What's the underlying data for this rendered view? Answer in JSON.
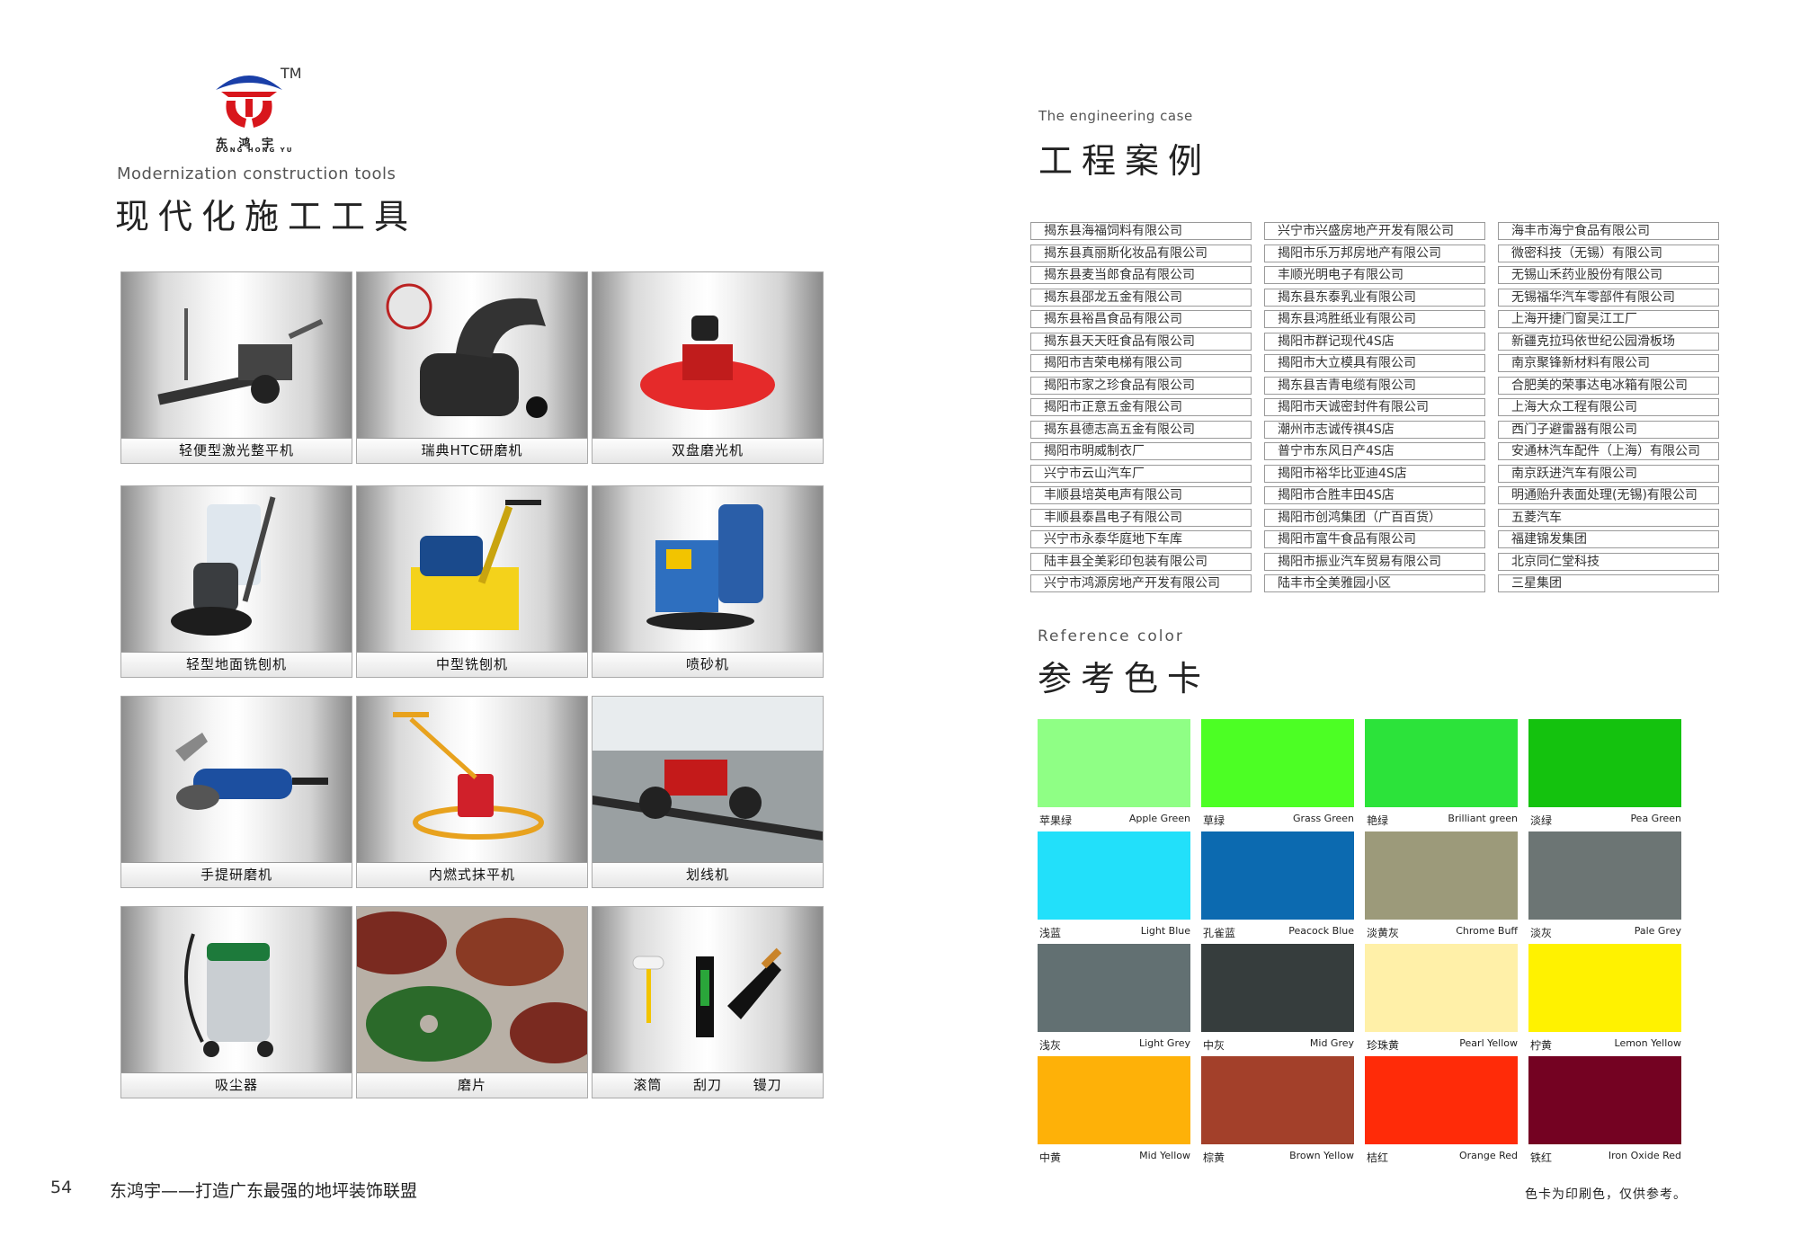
{
  "left": {
    "logo": {
      "tm": "TM",
      "name": "东 鸿 宇",
      "sub": "DONG HONG YU"
    },
    "title_en": "Modernization construction tools",
    "title_cn": "现代化施工工具",
    "tools": [
      {
        "label": "轻便型激光整平机"
      },
      {
        "label": "瑞典HTC研磨机"
      },
      {
        "label": "双盘磨光机"
      },
      {
        "label": "轻型地面铣刨机"
      },
      {
        "label": "中型铣刨机"
      },
      {
        "label": "喷砂机"
      },
      {
        "label": "手提研磨机"
      },
      {
        "label": "内燃式抹平机"
      },
      {
        "label": "划线机"
      },
      {
        "label": "吸尘器"
      },
      {
        "label": "磨片"
      },
      {
        "label": "滚筒      刮刀      镘刀"
      }
    ],
    "page_number": "54",
    "slogan": "东鸿宇——打造广东最强的地坪装饰联盟"
  },
  "right": {
    "cases_en": "The engineering case",
    "cases_cn": "工程案例",
    "cases": [
      [
        "揭东县海福饲料有限公司",
        "揭东县真丽斯化妆品有限公司",
        "揭东县麦当郎食品有限公司",
        "揭东县邵龙五金有限公司",
        "揭东县裕昌食品有限公司",
        "揭东县天天旺食品有限公司",
        "揭阳市吉荣电梯有限公司",
        "揭阳市家之珍食品有限公司",
        "揭阳市正意五金有限公司",
        "揭东县德志高五金有限公司",
        "揭阳市明威制衣厂",
        "兴宁市云山汽车厂",
        "丰顺县培英电声有限公司",
        "丰顺县泰昌电子有限公司",
        "兴宁市永泰华庭地下车库",
        "陆丰县全美彩印包装有限公司",
        "兴宁市鸿源房地产开发有限公司"
      ],
      [
        "兴宁市兴盛房地产开发有限公司",
        "揭阳市乐万邦房地产有限公司",
        "丰顺光明电子有限公司",
        "揭东县东泰乳业有限公司",
        "揭东县鸿胜纸业有限公司",
        "揭阳市群记现代4S店",
        "揭阳市大立模具有限公司",
        "揭东县吉青电缆有限公司",
        "揭阳市天诚密封件有限公司",
        "潮州市志诚传祺4S店",
        "普宁市东风日产4S店",
        "揭阳市裕华比亚迪4S店",
        "揭阳市合胜丰田4S店",
        "揭阳市创鸿集团（广百百货）",
        "揭阳市富牛食品有限公司",
        "揭阳市振业汽车贸易有限公司",
        "陆丰市全美雅园小区"
      ],
      [
        "海丰市海宁食品有限公司",
        "微密科技（无锡）有限公司",
        "无锡山禾药业股份有限公司",
        "无锡福华汽车零部件有限公司",
        "上海开捷门窗吴江工厂",
        "新疆克拉玛依世纪公园滑板场",
        "南京聚锋新材料有限公司",
        "合肥美的荣事达电冰箱有限公司",
        "上海大众工程有限公司",
        "西门子避雷器有限公司",
        "安通林汽车配件（上海）有限公司",
        "南京跃进汽车有限公司",
        "明通贻升表面处理(无锡)有限公司",
        "五菱汽车",
        "福建锦发集团",
        "北京同仁堂科技",
        "三星集团"
      ]
    ],
    "colors_en": "Reference color",
    "colors_cn": "参考色卡",
    "swatches": [
      {
        "cn": "苹果绿",
        "en": "Apple Green",
        "color": "#8fff85"
      },
      {
        "cn": "草绿",
        "en": "Grass Green",
        "color": "#4cff24"
      },
      {
        "cn": "艳绿",
        "en": "Brilliant green",
        "color": "#2ce33a"
      },
      {
        "cn": "淡绿",
        "en": "Pea Green",
        "color": "#14c20e"
      },
      {
        "cn": "浅蓝",
        "en": "Light Blue",
        "color": "#22e0fa"
      },
      {
        "cn": "孔雀蓝",
        "en": "Peacock Blue",
        "color": "#0c6ab0"
      },
      {
        "cn": "淡黄灰",
        "en": "Chrome Buff",
        "color": "#9c9a7a"
      },
      {
        "cn": "淡灰",
        "en": "Pale Grey",
        "color": "#6c7574"
      },
      {
        "cn": "浅灰",
        "en": "Light Grey",
        "color": "#627072"
      },
      {
        "cn": "中灰",
        "en": "Mid Grey",
        "color": "#363d3d"
      },
      {
        "cn": "珍珠黄",
        "en": "Pearl Yellow",
        "color": "#fff0a8"
      },
      {
        "cn": "柠黄",
        "en": "Lemon Yellow",
        "color": "#fff200"
      },
      {
        "cn": "中黄",
        "en": "Mid Yellow",
        "color": "#feb108"
      },
      {
        "cn": "棕黄",
        "en": "Brown Yellow",
        "color": "#a3402a"
      },
      {
        "cn": "桔红",
        "en": "Orange Red",
        "color": "#ff2b08"
      },
      {
        "cn": "铁红",
        "en": "Iron Oxide Red",
        "color": "#740222"
      }
    ],
    "note": "色卡为印刷色，仅供参考。"
  }
}
